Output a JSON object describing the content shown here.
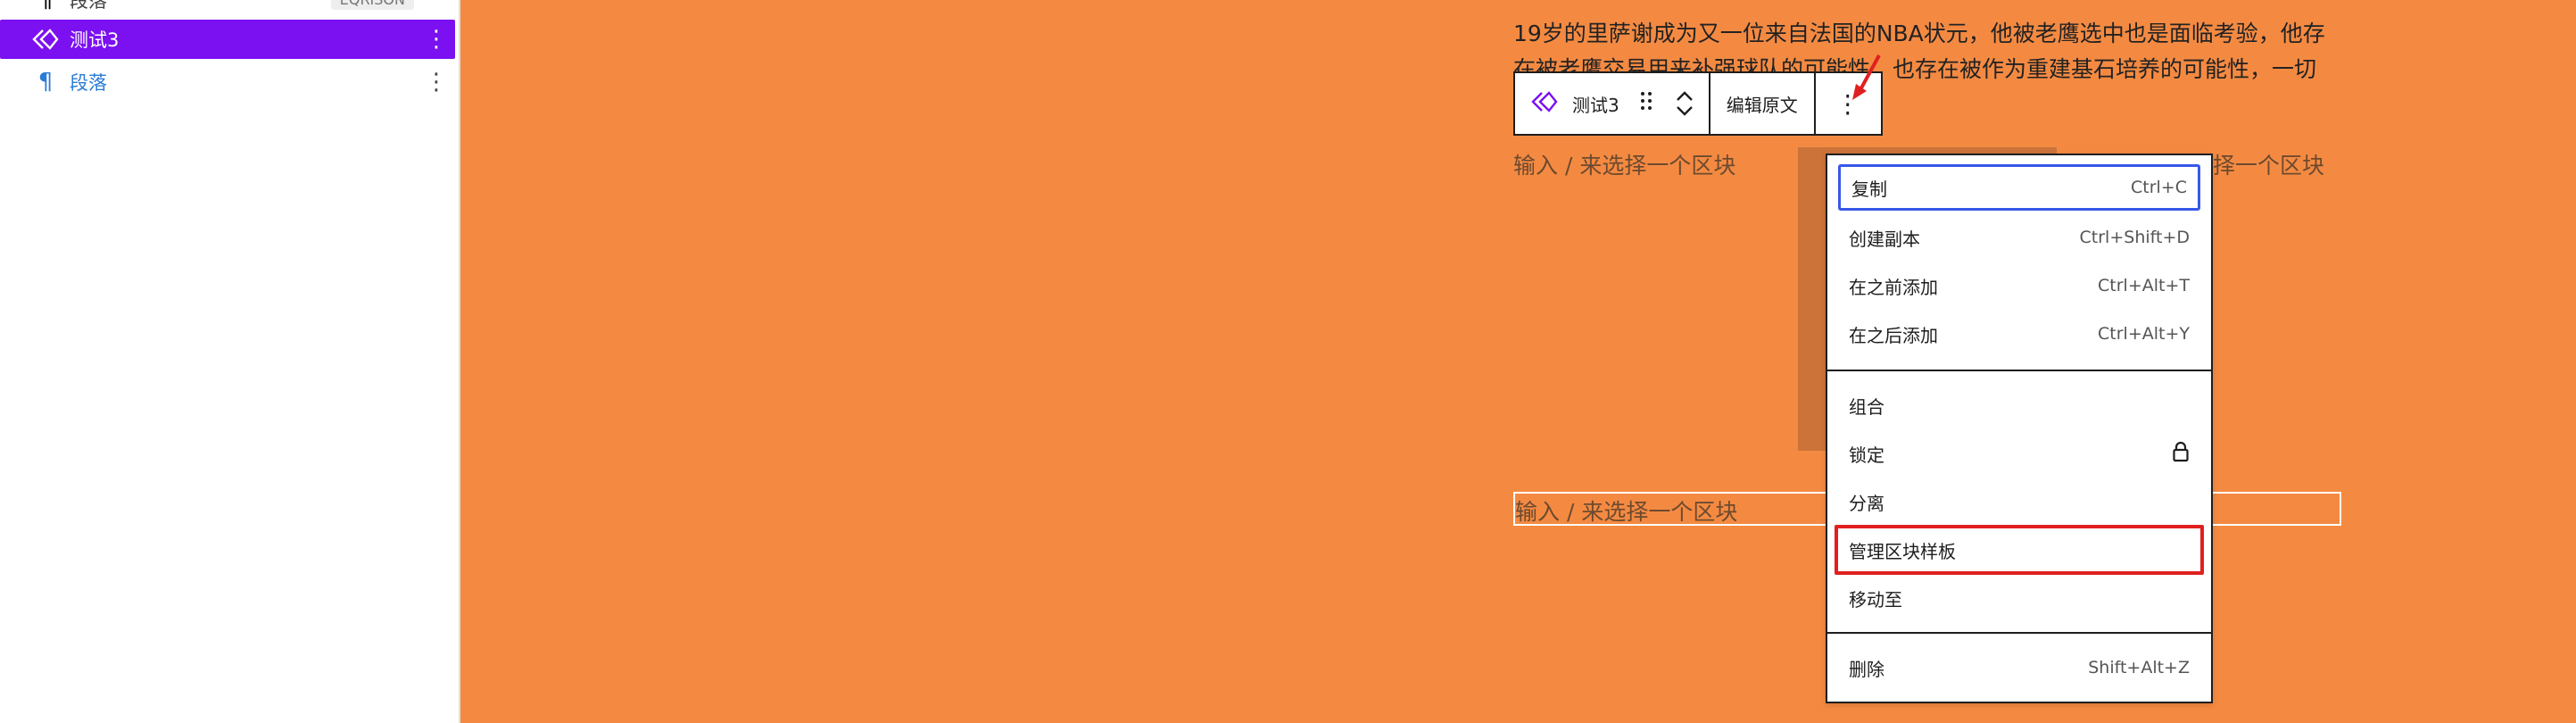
{
  "sidebar": {
    "top_item": {
      "label": "段落",
      "badge": "EQRISON"
    },
    "selected_item": {
      "label": "测试3"
    },
    "paragraph_item": {
      "label": "段落"
    }
  },
  "canvas": {
    "paragraph_text": "19岁的里萨谢成为又一位来自法国的NBA状元，他被老鹰选中也是面临考验，他存在被老鹰交易用来补强球队的可能性，也存在被作为重建基石培养的可能性，一切都取决于球队新的思路。",
    "placeholder_1": "输入 / 来选择一个区块",
    "placeholder_1_right": "择一个区块",
    "placeholder_2": "输入 / 来选择一个区块"
  },
  "toolbar": {
    "block_name": "测试3",
    "edit_label": "编辑原文",
    "more_symbol": "⋮"
  },
  "menu": {
    "group1": [
      {
        "label": "复制",
        "shortcut": "Ctrl+C"
      },
      {
        "label": "创建副本",
        "shortcut": "Ctrl+Shift+D"
      },
      {
        "label": "在之前添加",
        "shortcut": "Ctrl+Alt+T"
      },
      {
        "label": "在之后添加",
        "shortcut": "Ctrl+Alt+Y"
      }
    ],
    "group2": [
      {
        "label": "组合"
      },
      {
        "label": "锁定"
      },
      {
        "label": "分离"
      },
      {
        "label": "管理区块样板"
      },
      {
        "label": "移动至"
      }
    ],
    "group3": [
      {
        "label": "删除",
        "shortcut": "Shift+Alt+Z"
      }
    ]
  },
  "colors": {
    "canvas_bg": "#f48a42",
    "selected_bg": "#7b10f0",
    "link_blue": "#2a7bd6",
    "focus_blue": "#3858e9",
    "annotation_red": "#e02020"
  },
  "icons": {
    "block": "reusable-block-icon",
    "paragraph": "pilcrow-icon",
    "drag": "drag-handle-icon",
    "lock": "lock-icon",
    "more": "more-vertical-icon"
  }
}
